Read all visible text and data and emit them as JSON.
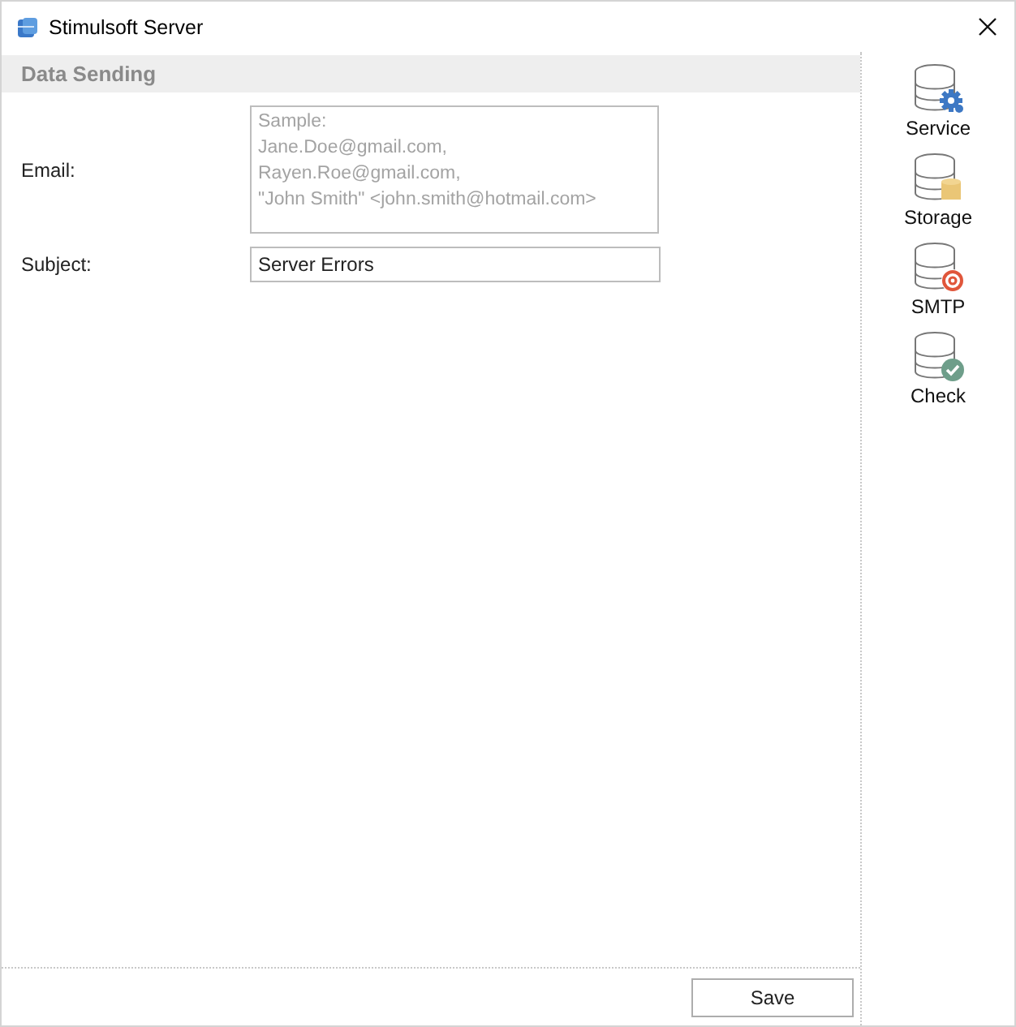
{
  "window": {
    "title": "Stimulsoft Server"
  },
  "section": {
    "title": "Data Sending"
  },
  "fields": [
    {
      "label": "Email:",
      "kind": "multiline",
      "placeholder": "Sample:\nJane.Doe@gmail.com,\nRayen.Roe@gmail.com,\n\"John Smith\" <john.smith@hotmail.com>"
    },
    {
      "label": "Subject:",
      "kind": "single",
      "value": "Server Errors"
    }
  ],
  "sidebar": {
    "items": [
      {
        "label": "Service",
        "kind": "gear"
      },
      {
        "label": "Storage",
        "kind": "storage"
      },
      {
        "label": "SMTP",
        "kind": "at"
      },
      {
        "label": "Check",
        "kind": "check"
      }
    ]
  },
  "buttons": [
    "Save"
  ]
}
